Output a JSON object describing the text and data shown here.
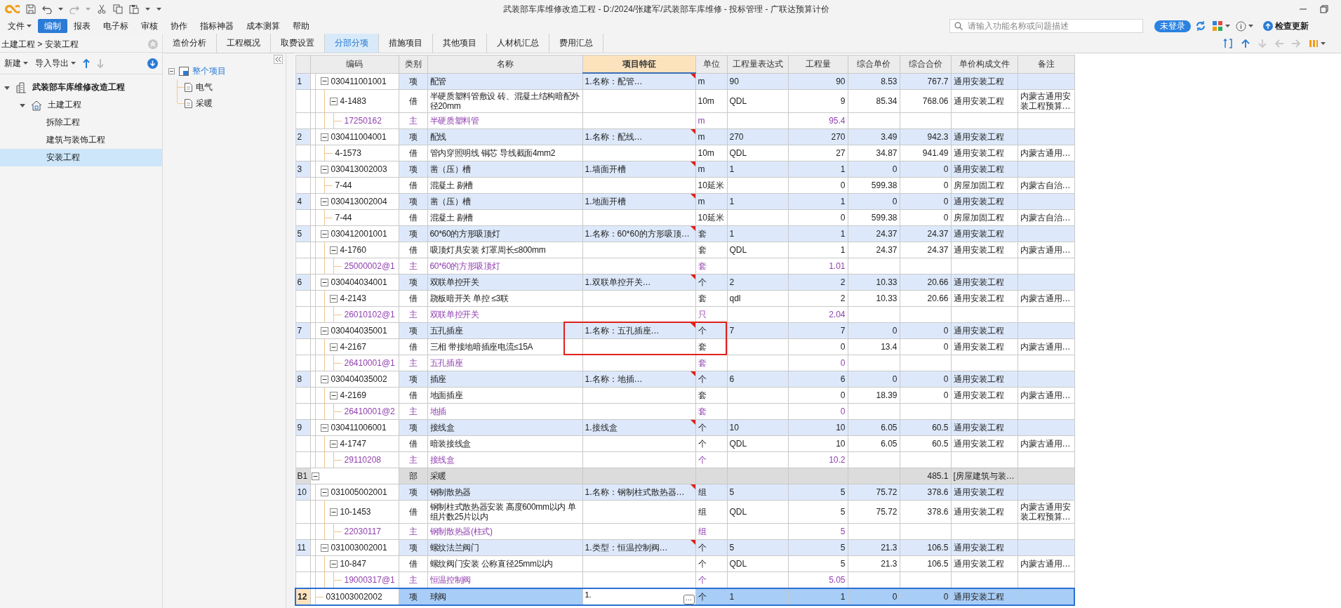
{
  "window": {
    "title": "武装部车库维修改造工程 - D:/2024/张建军/武装部车库维修 - 投标管理 - 广联达预算计价"
  },
  "menu": {
    "items": [
      {
        "label": "文件",
        "selected": false,
        "dropdown": true
      },
      {
        "label": "编制",
        "selected": true,
        "dropdown": false
      },
      {
        "label": "报表",
        "selected": false,
        "dropdown": false
      },
      {
        "label": "电子标",
        "selected": false,
        "dropdown": false
      },
      {
        "label": "审核",
        "selected": false,
        "dropdown": false
      },
      {
        "label": "协作",
        "selected": false,
        "dropdown": false
      },
      {
        "label": "指标神器",
        "selected": false,
        "dropdown": false
      },
      {
        "label": "成本测算",
        "selected": false,
        "dropdown": false
      },
      {
        "label": "帮助",
        "selected": false,
        "dropdown": false
      }
    ]
  },
  "search": {
    "placeholder": "请输入功能名称或问题描述"
  },
  "account": {
    "login": "未登录"
  },
  "update": {
    "label": "检查更新"
  },
  "sidebar": {
    "breadcrumb": "土建工程 > 安装工程",
    "actions": [
      {
        "label": "新建",
        "dropdown": true
      },
      {
        "label": "导入导出",
        "dropdown": true
      }
    ],
    "tree": [
      {
        "label": "武装部车库维修改造工程",
        "selected": false,
        "expanded": true,
        "children": [
          {
            "label": "土建工程",
            "selected": false,
            "expanded": true,
            "children": [
              {
                "label": "拆除工程",
                "selected": false
              },
              {
                "label": "建筑与装饰工程",
                "selected": false
              },
              {
                "label": "安装工程",
                "selected": true
              }
            ]
          }
        ]
      }
    ]
  },
  "tabs": [
    {
      "label": "造价分析",
      "selected": false
    },
    {
      "label": "工程概况",
      "selected": false
    },
    {
      "label": "取费设置",
      "selected": false
    },
    {
      "label": "分部分项",
      "selected": true
    },
    {
      "label": "措施项目",
      "selected": false
    },
    {
      "label": "其他项目",
      "selected": false
    },
    {
      "label": "人材机汇总",
      "selected": false
    },
    {
      "label": "费用汇总",
      "selected": false
    }
  ],
  "outline": {
    "tree": [
      {
        "label": "整个项目",
        "selected": true,
        "expanded": true,
        "children": [
          {
            "label": "电气",
            "selected": false
          },
          {
            "label": "采暖",
            "selected": false
          }
        ]
      }
    ]
  },
  "table": {
    "columns": [
      {
        "label": "编码",
        "selected": false
      },
      {
        "label": "类别",
        "selected": false
      },
      {
        "label": "名称",
        "selected": false
      },
      {
        "label": "项目特征",
        "selected": true
      },
      {
        "label": "单位",
        "selected": false
      },
      {
        "label": "工程量表达式",
        "selected": false
      },
      {
        "label": "工程量",
        "selected": false
      },
      {
        "label": "综合单价",
        "selected": false
      },
      {
        "label": "综合合价",
        "selected": false
      },
      {
        "label": "单价构成文件",
        "selected": false
      },
      {
        "label": "备注",
        "selected": false
      }
    ],
    "rows": [
      {
        "kind": "item",
        "seq": "1",
        "code": "030411001001",
        "type": "项",
        "name": "配管",
        "feature": "1.名称：配管…",
        "flagged": true,
        "unit": "m",
        "expr": "90",
        "qty": "90",
        "price": "8.53",
        "total": "767.7",
        "price_file": "通用安装工程",
        "expanded": true,
        "selected": false,
        "children": [
          {
            "kind": "quota",
            "code": "4-1483",
            "type": "借",
            "name": "半硬质塑料管敷设 砖、混凝土结构暗配外径20mm",
            "unit": "10m",
            "expr": "QDL",
            "qty": "9",
            "price": "85.34",
            "total": "768.06",
            "price_file": "通用安装工程",
            "note": "内蒙古通用安装工程预算…",
            "expanded": true,
            "selected": false,
            "children": [
              {
                "kind": "material",
                "code": "17250162",
                "type": "主",
                "name": "半硬质塑料管",
                "unit": "m",
                "qty": "95.4",
                "selected": false
              }
            ]
          }
        ]
      },
      {
        "kind": "item",
        "seq": "2",
        "code": "030411004001",
        "type": "项",
        "name": "配线",
        "feature": "1.名称：配线…",
        "flagged": true,
        "unit": "m",
        "expr": "270",
        "qty": "270",
        "price": "3.49",
        "total": "942.3",
        "price_file": "通用安装工程",
        "expanded": true,
        "selected": false,
        "children": [
          {
            "kind": "quota",
            "code": "4-1573",
            "type": "借",
            "name": "管内穿照明线 铜芯 导线截面4mm2",
            "unit": "10m",
            "expr": "QDL",
            "qty": "27",
            "price": "34.87",
            "total": "941.49",
            "price_file": "通用安装工程",
            "note": "内蒙古通用…",
            "selected": false
          }
        ]
      },
      {
        "kind": "item",
        "seq": "3",
        "code": "030413002003",
        "type": "项",
        "name": "凿（压）槽",
        "feature": "1.墙面开槽",
        "flagged": true,
        "unit": "m",
        "expr": "1",
        "qty": "1",
        "price": "0",
        "total": "0",
        "price_file": "通用安装工程",
        "expanded": true,
        "selected": false,
        "children": [
          {
            "kind": "quota",
            "code": "7-44",
            "type": "借",
            "name": "混凝土 剔槽",
            "unit": "10延米",
            "qty": "0",
            "price": "599.38",
            "total": "0",
            "price_file": "房屋加固工程",
            "note": "内蒙古自治…",
            "selected": false
          }
        ]
      },
      {
        "kind": "item",
        "seq": "4",
        "code": "030413002004",
        "type": "项",
        "name": "凿（压）槽",
        "feature": "1.地面开槽",
        "flagged": true,
        "unit": "m",
        "expr": "1",
        "qty": "1",
        "price": "0",
        "total": "0",
        "price_file": "通用安装工程",
        "expanded": true,
        "selected": false,
        "children": [
          {
            "kind": "quota",
            "code": "7-44",
            "type": "借",
            "name": "混凝土 剔槽",
            "unit": "10延米",
            "qty": "0",
            "price": "599.38",
            "total": "0",
            "price_file": "房屋加固工程",
            "note": "内蒙古自治…",
            "selected": false
          }
        ]
      },
      {
        "kind": "item",
        "seq": "5",
        "code": "030412001001",
        "type": "项",
        "name": "60*60的方形吸顶灯",
        "feature": "1.名称：60*60的方形吸顶…",
        "flagged": true,
        "unit": "套",
        "expr": "1",
        "qty": "1",
        "price": "24.37",
        "total": "24.37",
        "price_file": "通用安装工程",
        "expanded": true,
        "selected": false,
        "children": [
          {
            "kind": "quota",
            "code": "4-1760",
            "type": "借",
            "name": "吸顶灯具安装 灯罩周长≤800mm",
            "unit": "套",
            "expr": "QDL",
            "qty": "1",
            "price": "24.37",
            "total": "24.37",
            "price_file": "通用安装工程",
            "note": "内蒙古通用…",
            "expanded": true,
            "selected": false,
            "children": [
              {
                "kind": "material",
                "code": "25000002@1",
                "type": "主",
                "name": "60*60的方形吸顶灯",
                "unit": "套",
                "qty": "1.01",
                "selected": false
              }
            ]
          }
        ]
      },
      {
        "kind": "item",
        "seq": "6",
        "code": "030404034001",
        "type": "项",
        "name": "双联单控开关",
        "feature": "1.双联单控开关…",
        "flagged": true,
        "unit": "个",
        "expr": "2",
        "qty": "2",
        "price": "10.33",
        "total": "20.66",
        "price_file": "通用安装工程",
        "expanded": true,
        "selected": false,
        "children": [
          {
            "kind": "quota",
            "code": "4-2143",
            "type": "借",
            "name": "跷板暗开关 单控 ≤3联",
            "unit": "套",
            "expr": "qdl",
            "qty": "2",
            "price": "10.33",
            "total": "20.66",
            "price_file": "通用安装工程",
            "note": "内蒙古通用…",
            "expanded": true,
            "selected": false,
            "children": [
              {
                "kind": "material",
                "code": "26010102@1",
                "type": "主",
                "name": "双联单控开关",
                "unit": "只",
                "qty": "2.04",
                "selected": false
              }
            ]
          }
        ]
      },
      {
        "kind": "item",
        "seq": "7",
        "code": "030404035001",
        "type": "项",
        "name": "五孔插座",
        "feature": "1.名称：五孔插座…",
        "flagged": true,
        "outlined": true,
        "unit": "个",
        "expr": "7",
        "qty": "7",
        "price": "0",
        "total": "0",
        "price_file": "通用安装工程",
        "expanded": true,
        "selected": false,
        "children": [
          {
            "kind": "quota",
            "code": "4-2167",
            "type": "借",
            "name": "三相 带接地暗插座电流≤15A",
            "unit": "套",
            "qty": "0",
            "price": "13.4",
            "total": "0",
            "price_file": "通用安装工程",
            "note": "内蒙古通用…",
            "expanded": true,
            "selected": false,
            "children": [
              {
                "kind": "material",
                "code": "26410001@1",
                "type": "主",
                "name": "五孔插座",
                "unit": "套",
                "qty": "0",
                "selected": false
              }
            ]
          }
        ]
      },
      {
        "kind": "item",
        "seq": "8",
        "code": "030404035002",
        "type": "项",
        "name": "插座",
        "feature": "1.名称：地插…",
        "flagged": true,
        "unit": "个",
        "expr": "6",
        "qty": "6",
        "price": "0",
        "total": "0",
        "price_file": "通用安装工程",
        "expanded": true,
        "selected": false,
        "children": [
          {
            "kind": "quota",
            "code": "4-2169",
            "type": "借",
            "name": "地面插座",
            "unit": "套",
            "qty": "0",
            "price": "18.39",
            "total": "0",
            "price_file": "通用安装工程",
            "note": "内蒙古通用…",
            "expanded": true,
            "selected": false,
            "children": [
              {
                "kind": "material",
                "code": "26410001@2",
                "type": "主",
                "name": "地插",
                "unit": "套",
                "qty": "0",
                "selected": false
              }
            ]
          }
        ]
      },
      {
        "kind": "item",
        "seq": "9",
        "code": "030411006001",
        "type": "项",
        "name": "接线盒",
        "feature": "1.接线盒",
        "flagged": true,
        "unit": "个",
        "expr": "10",
        "qty": "10",
        "price": "6.05",
        "total": "60.5",
        "price_file": "通用安装工程",
        "expanded": true,
        "selected": false,
        "children": [
          {
            "kind": "quota",
            "code": "4-1747",
            "type": "借",
            "name": "暗装接线盒",
            "unit": "个",
            "expr": "QDL",
            "qty": "10",
            "price": "6.05",
            "total": "60.5",
            "price_file": "通用安装工程",
            "note": "内蒙古通用…",
            "expanded": true,
            "selected": false,
            "children": [
              {
                "kind": "material",
                "code": "29110208",
                "type": "主",
                "name": "接线盒",
                "unit": "个",
                "qty": "10.2",
                "selected": false
              }
            ]
          }
        ]
      },
      {
        "kind": "section",
        "seq": "B1",
        "type": "部",
        "name": "采暖",
        "total": "485.1",
        "price_file": "[房屋建筑与装…",
        "expanded": true,
        "selected": false,
        "children": [
          {
            "kind": "item",
            "seq": "10",
            "code": "031005002001",
            "type": "项",
            "name": "钢制散热器",
            "feature": "1.名称：钢制柱式散热器…",
            "flagged": true,
            "unit": "组",
            "expr": "5",
            "qty": "5",
            "price": "75.72",
            "total": "378.6",
            "price_file": "通用安装工程",
            "expanded": true,
            "selected": false,
            "children": [
              {
                "kind": "quota",
                "code": "10-1453",
                "type": "借",
                "name": "钢制柱式散热器安装 高度600mm以内 单组片数25片以内",
                "unit": "组",
                "expr": "QDL",
                "qty": "5",
                "price": "75.72",
                "total": "378.6",
                "price_file": "通用安装工程",
                "note": "内蒙古通用安装工程预算…",
                "expanded": true,
                "selected": false,
                "children": [
                  {
                    "kind": "material",
                    "code": "22030117",
                    "type": "主",
                    "name": "钢制散热器(柱式)",
                    "unit": "组",
                    "qty": "5",
                    "selected": false
                  }
                ]
              }
            ]
          },
          {
            "kind": "item",
            "seq": "11",
            "code": "031003002001",
            "type": "项",
            "name": "螺纹法兰阀门",
            "feature": "1.类型：恒温控制阀…",
            "flagged": true,
            "unit": "个",
            "expr": "5",
            "qty": "5",
            "price": "21.3",
            "total": "106.5",
            "price_file": "通用安装工程",
            "expanded": true,
            "selected": false,
            "children": [
              {
                "kind": "quota",
                "code": "10-847",
                "type": "借",
                "name": "螺纹阀门安装 公称直径25mm以内",
                "unit": "个",
                "expr": "QDL",
                "qty": "5",
                "price": "21.3",
                "total": "106.5",
                "price_file": "通用安装工程",
                "note": "内蒙古通用…",
                "expanded": true,
                "selected": false,
                "children": [
                  {
                    "kind": "material",
                    "code": "19000317@1",
                    "type": "主",
                    "name": "恒温控制阀",
                    "unit": "个",
                    "qty": "5.05",
                    "selected": false
                  }
                ]
              }
            ]
          },
          {
            "kind": "item",
            "seq": "12",
            "code": "031003002002",
            "type": "项",
            "name": "球阀",
            "feature": "1.",
            "flagged": false,
            "editing": true,
            "edit_button": "···",
            "unit": "个",
            "expr": "1",
            "qty": "1",
            "price": "0",
            "total": "0",
            "price_file": "通用安装工程",
            "selected": true
          }
        ]
      }
    ]
  }
}
